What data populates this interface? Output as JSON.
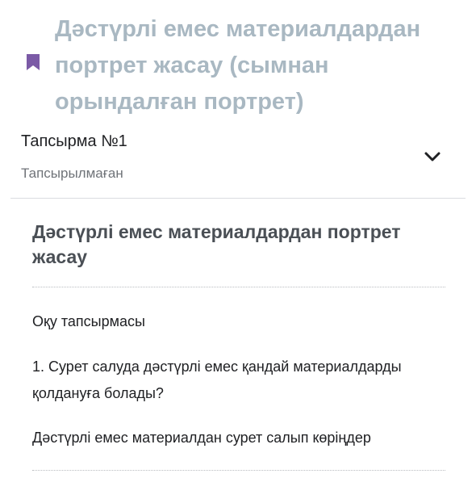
{
  "topic": {
    "icon": "bookmark-icon",
    "icon_color": "#7b5aa6",
    "title": "Дәстүрлі емес материалдардан портрет жасау (сымнан орындалған портрет)"
  },
  "assignment": {
    "title": "Тапсырма №1",
    "status": "Тапсырылмаған",
    "toggle_icon": "chevron-down-icon"
  },
  "content": {
    "heading": "Дәстүрлі емес материалдардан портрет жасау",
    "task_label": "Оқу тапсырмасы",
    "question": "1. Сурет салуда дәстүрлі емес қандай материалдарды қолдануға болады?",
    "instruction": "Дәстүрлі емес материалдан сурет салып көріңдер"
  }
}
